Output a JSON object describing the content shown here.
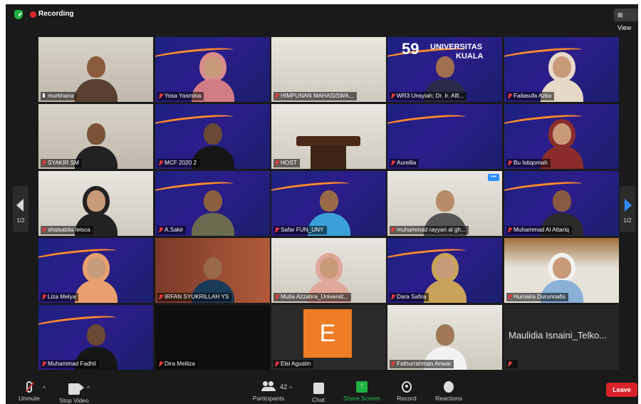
{
  "topbar": {
    "recording": "Recording",
    "view": "View"
  },
  "nav": {
    "page_indicator": "1/2"
  },
  "colors": {
    "active_speaker": "#c7e02c",
    "leave": "#d9232b",
    "share": "#1fb141",
    "recording": "#e02828"
  },
  "tiles": [
    {
      "name": "murkhana"
    },
    {
      "name": "Yosa Yasmina"
    },
    {
      "name": "HIMPUNAN MAHASISWA..."
    },
    {
      "name": "WR3 Unsyiah; Dr. Ir. Alfi..."
    },
    {
      "name": "Failasufa Azka"
    },
    {
      "name": "SYAKIR SM"
    },
    {
      "name": "MCF 2020 2"
    },
    {
      "name": "HOST"
    },
    {
      "name": "Aurellia"
    },
    {
      "name": "Bu Istiqomah"
    },
    {
      "name": "shalsabila leisca"
    },
    {
      "name": "A.Sakir"
    },
    {
      "name": "Safar FUN_UNY"
    },
    {
      "name": "muhammad rayyan al gh..."
    },
    {
      "name": "Muhammad Al Attariq"
    },
    {
      "name": "Liza Melya"
    },
    {
      "name": "IRFAN SYUKRILLAH YS"
    },
    {
      "name": "Mutia Azzahra_Universit..."
    },
    {
      "name": "Dara Safira"
    },
    {
      "name": "Humaira Durunnafis"
    },
    {
      "name": "Muhammad Fadhil"
    },
    {
      "name": "Dira Meiliza"
    },
    {
      "name": "Elsi Agustin"
    },
    {
      "name": "Fathurrahman Anwar"
    },
    {
      "name": "Maulidia Isnaini_Telko..."
    }
  ],
  "banner": {
    "year": "59",
    "title": "UNIVERSITAS",
    "subtitle": "KUALA"
  },
  "avatar": {
    "letter": "E"
  },
  "toolbar": {
    "unmute": "Unmute",
    "stop_video": "Stop Video",
    "participants": "Participants",
    "participants_count": "42",
    "chat": "Chat",
    "share_screen": "Share Screen",
    "record": "Record",
    "reactions": "Reactions",
    "leave": "Leave"
  }
}
